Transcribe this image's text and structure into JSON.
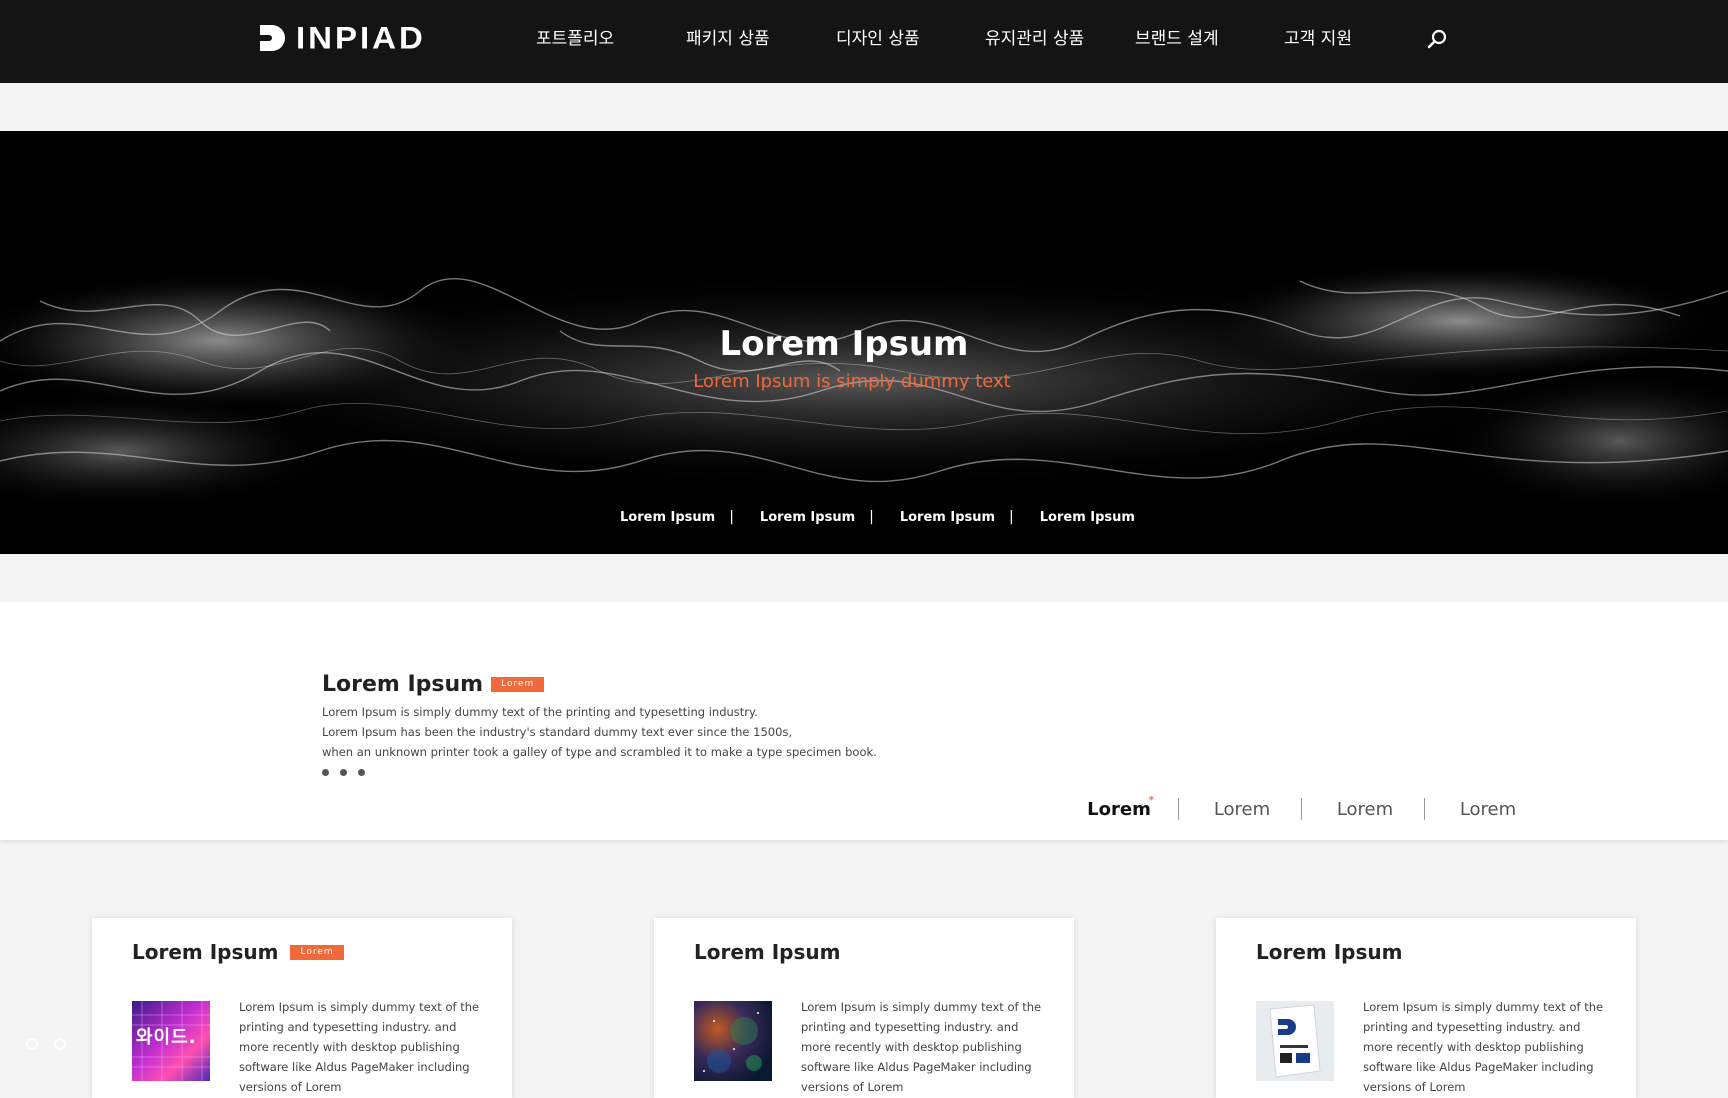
{
  "brand": {
    "logo_text": "INPIAD",
    "logo_icon": "d-logo-icon"
  },
  "nav": {
    "items": [
      {
        "label": "포트폴리오"
      },
      {
        "label": "패키지 상품"
      },
      {
        "label": "디자인 상품"
      },
      {
        "label": "유지관리 상품"
      },
      {
        "label": "브랜드 설계"
      },
      {
        "label": "고객 지원"
      }
    ],
    "search_icon": "search-icon"
  },
  "hero": {
    "title": "Lorem Ipsum",
    "subtitle": "Lorem Ipsum is simply dummy text",
    "links": [
      "Lorem Ipsum",
      "Lorem Ipsum",
      "Lorem Ipsum",
      "Lorem Ipsum"
    ],
    "separator": "|"
  },
  "intro": {
    "title": "Lorem Ipsum",
    "badge": "Lorem",
    "lines": [
      "Lorem Ipsum is simply dummy text of the printing and typesetting industry.",
      "Lorem Ipsum has been the industry's standard dummy text ever since the 1500s,",
      "when an unknown printer took a galley of type and scrambled it to make a type specimen book."
    ],
    "tabs": [
      {
        "label": "Lorem",
        "active": true,
        "marker": "*"
      },
      {
        "label": "Lorem",
        "active": false
      },
      {
        "label": "Lorem",
        "active": false
      },
      {
        "label": "Lorem",
        "active": false
      }
    ]
  },
  "cards": [
    {
      "title": "Lorem Ipsum",
      "badge": "Lorem",
      "thumb_text": "와이드.",
      "text": "Lorem Ipsum is simply dummy text of the printing and typesetting industry. and more recently with desktop publishing software like Aldus PageMaker including versions of Lorem"
    },
    {
      "title": "Lorem Ipsum",
      "text": "Lorem Ipsum is simply dummy text of the printing and typesetting industry. and more recently with desktop publishing software like Aldus PageMaker including versions of Lorem"
    },
    {
      "title": "Lorem Ipsum",
      "text": "Lorem Ipsum is simply dummy text of the printing and typesetting industry. and more recently with desktop publishing software like Aldus PageMaker including versions of Lorem"
    }
  ],
  "colors": {
    "accent": "#f0693b",
    "header_bg": "#141414",
    "page_bg": "#f4f4f4"
  }
}
